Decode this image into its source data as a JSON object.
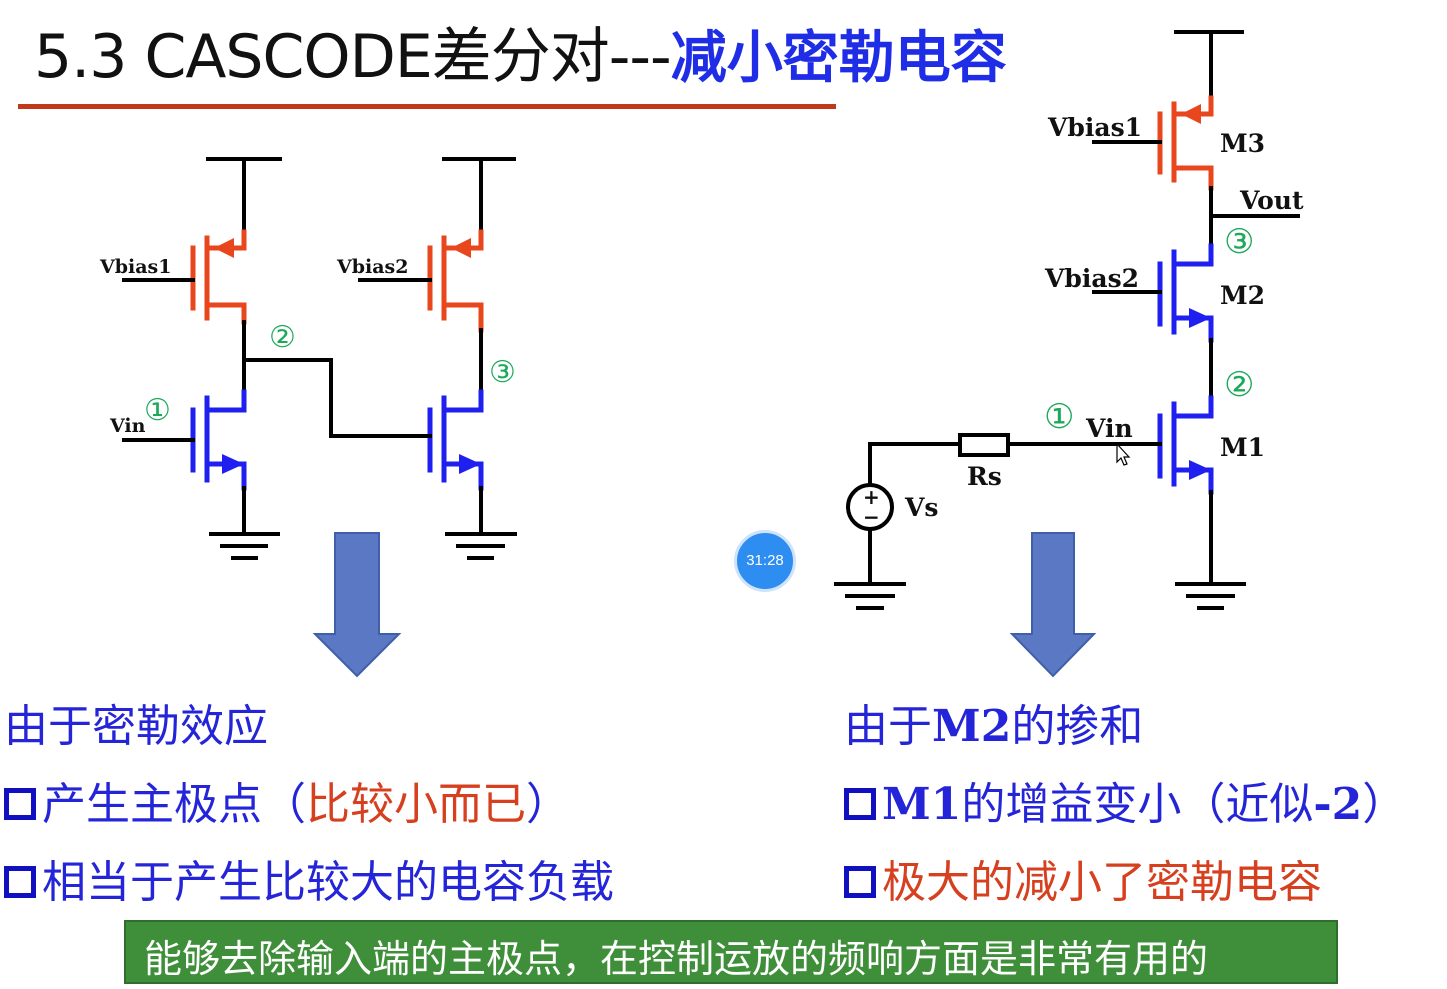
{
  "title": {
    "main": "5.3 CASCODE差分对---",
    "sub": "减小密勒电容"
  },
  "left_circuit": {
    "vbias1": "Vbias1",
    "vbias2": "Vbias2",
    "vin": "Vin",
    "node1": "①",
    "node2": "②",
    "node3": "③"
  },
  "right_circuit": {
    "vbias1": "Vbias1",
    "vbias2": "Vbias2",
    "vin": "Vin",
    "vout": "Vout",
    "m1": "M1",
    "m2": "M2",
    "m3": "M3",
    "rs": "Rs",
    "vs": "Vs",
    "node1": "①",
    "node2": "②",
    "node3": "③",
    "plus": "+",
    "minus": "−"
  },
  "timer": "31:28",
  "left_text": {
    "heading": "由于密勒效应",
    "bullet1_black": "产生主极点（",
    "bullet1_red": "比较小而已",
    "bullet1_end": "）",
    "bullet2": "相当于产生比较大的电容负载"
  },
  "right_text": {
    "heading_pre": "由于",
    "heading_bold": "M2",
    "heading_post": "的掺和",
    "bullet1_bold": "M1",
    "bullet1_rest": "的增益变小（近似",
    "bullet1_val": "-2",
    "bullet1_end": "）",
    "bullet2": "极大的减小了密勒电容"
  },
  "banner": "能够去除输入端的主极点，在控制运放的频响方面是非常有用的",
  "colors": {
    "pmos": "#e8461c",
    "nmos": "#1f1ff0",
    "wire": "#000000",
    "node_label": "#1ea85a",
    "arrow": "#5b78c4",
    "title_rule": "#c0391b",
    "banner": "#3f8f3a"
  }
}
